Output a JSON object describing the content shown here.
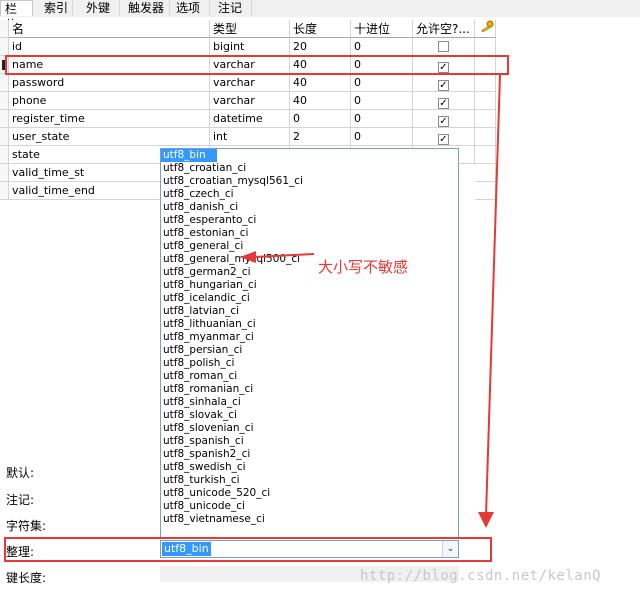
{
  "tabs": [
    "栏位",
    "索引",
    "外键",
    "触发器",
    "选项",
    "注记"
  ],
  "columns": [
    "名",
    "类型",
    "长度",
    "十进位",
    "允许空?..."
  ],
  "rows": [
    {
      "name": "id",
      "type": "bigint",
      "length": "20",
      "decimal": "0",
      "nullable": false,
      "key": true
    },
    {
      "name": "name",
      "type": "varchar",
      "length": "40",
      "decimal": "0",
      "nullable": true,
      "key": false
    },
    {
      "name": "password",
      "type": "varchar",
      "length": "40",
      "decimal": "0",
      "nullable": true,
      "key": false
    },
    {
      "name": "phone",
      "type": "varchar",
      "length": "40",
      "decimal": "0",
      "nullable": true,
      "key": false
    },
    {
      "name": "register_time",
      "type": "datetime",
      "length": "0",
      "decimal": "0",
      "nullable": true,
      "key": false
    },
    {
      "name": "user_state",
      "type": "int",
      "length": "2",
      "decimal": "0",
      "nullable": true,
      "key": false
    },
    {
      "name": "state",
      "type": "",
      "length": "",
      "decimal": "",
      "nullable": null,
      "key": false
    },
    {
      "name": "valid_time_st",
      "type": "",
      "length": "",
      "decimal": "",
      "nullable": null,
      "key": false
    },
    {
      "name": "valid_time_end",
      "type": "",
      "length": "",
      "decimal": "",
      "nullable": null,
      "key": false
    }
  ],
  "collation_options": [
    "utf8_bin",
    "utf8_croatian_ci",
    "utf8_croatian_mysql561_ci",
    "utf8_czech_ci",
    "utf8_danish_ci",
    "utf8_esperanto_ci",
    "utf8_estonian_ci",
    "utf8_general_ci",
    "utf8_general_mysql500_ci",
    "utf8_german2_ci",
    "utf8_hungarian_ci",
    "utf8_icelandic_ci",
    "utf8_latvian_ci",
    "utf8_lithuanian_ci",
    "utf8_myanmar_ci",
    "utf8_persian_ci",
    "utf8_polish_ci",
    "utf8_roman_ci",
    "utf8_romanian_ci",
    "utf8_sinhala_ci",
    "utf8_slovak_ci",
    "utf8_slovenian_ci",
    "utf8_spanish_ci",
    "utf8_spanish2_ci",
    "utf8_swedish_ci",
    "utf8_turkish_ci",
    "utf8_unicode_520_ci",
    "utf8_unicode_ci",
    "utf8_vietnamese_ci"
  ],
  "selected_collation": "utf8_bin",
  "fields": {
    "default_label": "默认:",
    "comment_label": "注记:",
    "charset_label": "字符集:",
    "collation_label": "整理:",
    "keylength_label": "键长度:"
  },
  "annotation": "大小写不敏感",
  "watermark": "http://blog.csdn.net/kelanQ",
  "colors": {
    "highlight": "#e53935",
    "selection": "#3399ff"
  },
  "icons": {
    "primary_key": "key-icon",
    "dropdown": "chevron-down-icon",
    "row_marker": "row-pointer-icon"
  }
}
